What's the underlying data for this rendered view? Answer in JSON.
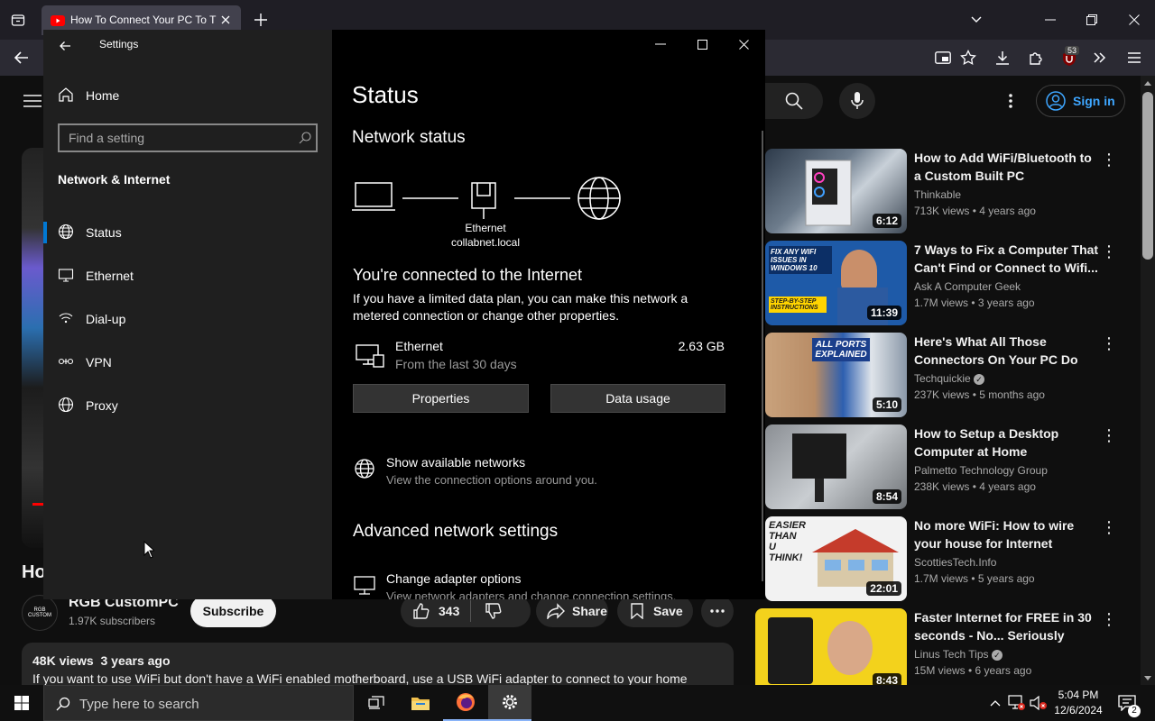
{
  "browser": {
    "tab_title": "How To Connect Your PC To The Internet",
    "tab_count_badge": "53"
  },
  "youtube": {
    "sign_in": "Sign in",
    "partial_title": "Ho",
    "channel_name": "RGB CustomPC",
    "channel_avatar_text": "RGB CUSTOM",
    "subscribers": "1.97K subscribers",
    "subscribe": "Subscribe",
    "likes": "343",
    "share": "Share",
    "save": "Save",
    "desc_meta": "48K views  3 years ago",
    "desc_text": "If you want to use WiFi but don't have a WiFi enabled motherboard, use a USB WiFi adapter to connect to your home",
    "recommendations": [
      {
        "title": "How to Add WiFi/Bluetooth to a Custom Built PC",
        "channel": "Thinkable",
        "meta": "713K views • 4 years ago",
        "duration": "6:12"
      },
      {
        "title": "7 Ways to Fix a Computer That Can't Find or Connect to Wifi...",
        "channel": "Ask A Computer Geek",
        "meta": "1.7M views • 3 years ago",
        "duration": "11:39",
        "thumb_text": "FIX ANY WIFI ISSUES IN WINDOWS 10",
        "thumb_text2": "STEP-BY-STEP INSTRUCTIONS"
      },
      {
        "title": "Here's What All Those Connectors On Your PC Do",
        "channel": "Techquickie",
        "meta": "237K views • 5 months ago",
        "duration": "5:10",
        "thumb_text": "ALL PORTS EXPLAINED"
      },
      {
        "title": "How to Setup a Desktop Computer at Home",
        "channel": "Palmetto Technology Group",
        "meta": "238K views • 4 years ago",
        "duration": "8:54"
      },
      {
        "title": "No more WiFi: How to wire your house for Internet",
        "channel": "ScottiesTech.Info",
        "meta": "1.7M views • 5 years ago",
        "duration": "22:01",
        "thumb_text": "EASIER THAN U THINK!"
      },
      {
        "title": "Faster Internet for FREE in 30 seconds - No... Seriously",
        "channel": "Linus Tech Tips",
        "meta": "15M views • 6 years ago",
        "duration": "8:43"
      }
    ]
  },
  "settings": {
    "window_title": "Settings",
    "home": "Home",
    "search_placeholder": "Find a setting",
    "section": "Network & Internet",
    "nav": [
      "Status",
      "Ethernet",
      "Dial-up",
      "VPN",
      "Proxy"
    ],
    "page_title": "Status",
    "network_status_heading": "Network status",
    "diagram_label_1": "Ethernet",
    "diagram_label_2": "collabnet.local",
    "connected_heading": "You're connected to the Internet",
    "connected_desc": "If you have a limited data plan, you can make this network a metered connection or change other properties.",
    "adapter_name": "Ethernet",
    "adapter_sub": "From the last 30 days",
    "adapter_usage": "2.63 GB",
    "properties_button": "Properties",
    "data_usage_button": "Data usage",
    "show_networks_title": "Show available networks",
    "show_networks_desc": "View the connection options around you.",
    "advanced_heading": "Advanced network settings",
    "change_adapter_title": "Change adapter options",
    "change_adapter_desc": "View network adapters and change connection settings."
  },
  "taskbar": {
    "search_placeholder": "Type here to search",
    "time": "5:04 PM",
    "date": "12/6/2024",
    "notification_count": "2"
  },
  "colors": {
    "accent_blue": "#0078d4",
    "youtube_red": "#ff0000",
    "settings_sidebar": "#1f1f1f"
  }
}
